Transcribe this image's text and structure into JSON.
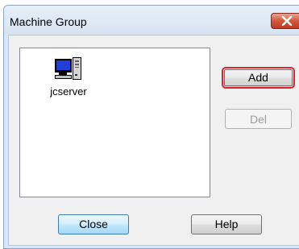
{
  "window": {
    "title": "Machine Group",
    "close_icon": "close-x-icon"
  },
  "machine_list": {
    "items": [
      {
        "label": "jcserver",
        "icon": "computer-icon"
      }
    ]
  },
  "buttons": {
    "add_label": "Add",
    "del_label": "Del",
    "close_label": "Close",
    "help_label": "Help"
  },
  "colors": {
    "highlight_border": "#e0222e",
    "title_bar": "#d6e3f1",
    "close_button": "#c0391f"
  }
}
